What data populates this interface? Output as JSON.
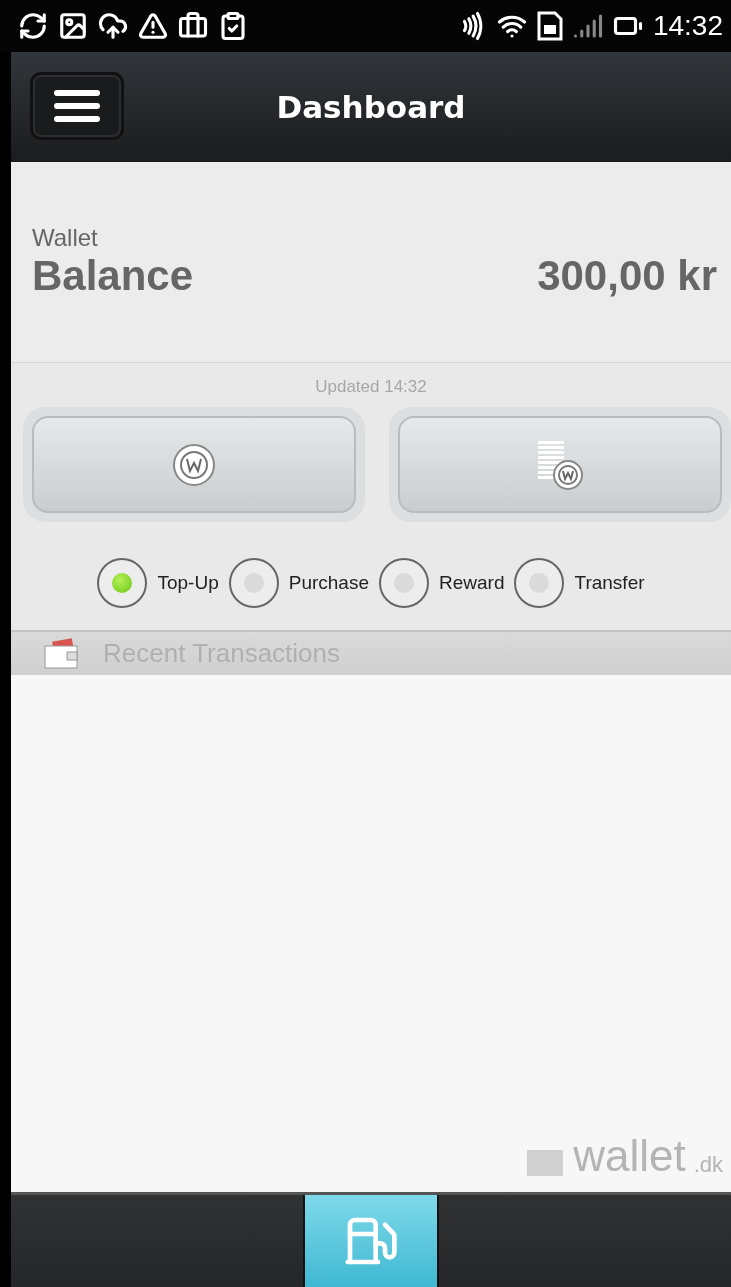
{
  "status_bar": {
    "time": "14:32"
  },
  "header": {
    "title": "Dashboard"
  },
  "wallet": {
    "label": "Wallet",
    "title": "Balance",
    "amount": "300,00 kr"
  },
  "updated": "Updated 14:32",
  "filters": [
    {
      "label": "Top-Up",
      "selected": true
    },
    {
      "label": "Purchase",
      "selected": false
    },
    {
      "label": "Reward",
      "selected": false
    },
    {
      "label": "Transfer",
      "selected": false
    }
  ],
  "recent": {
    "title": "Recent Transactions"
  },
  "brand": {
    "name": "wallet",
    "suffix": ".dk"
  },
  "bottom_tabs": [
    {
      "selected": false
    },
    {
      "selected": true,
      "kind": "fuel"
    },
    {
      "selected": false
    }
  ]
}
